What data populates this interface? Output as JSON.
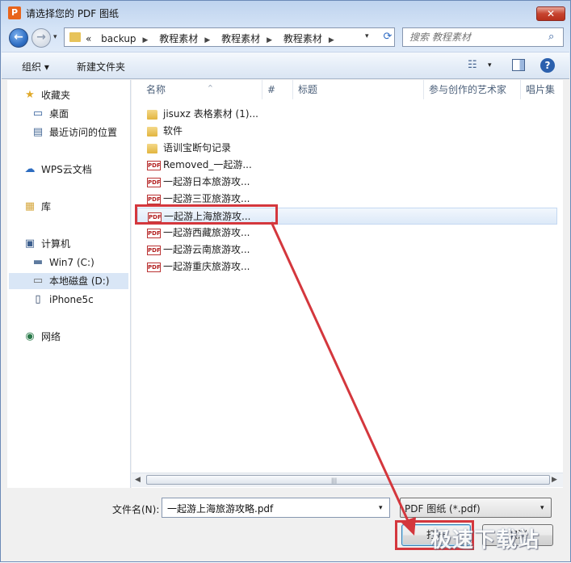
{
  "window": {
    "title": "请选择您的 PDF 图纸",
    "app_icon_letter": "P",
    "close_glyph": "✕"
  },
  "nav": {
    "back_glyph": "←",
    "forward_glyph": "→",
    "dropdown_glyph": "▾",
    "overflow": "«",
    "breadcrumbs": [
      "backup",
      "教程素材",
      "教程素材",
      "教程素材"
    ],
    "breadcrumb_sep": "▶",
    "search_placeholder": "搜索 教程素材"
  },
  "toolbar": {
    "organize": "组织 ▾",
    "new_folder": "新建文件夹",
    "views_glyph": "☷",
    "help_glyph": "?"
  },
  "sidebar": {
    "items": [
      {
        "label": "收藏夹",
        "icon": "★"
      },
      {
        "label": "桌面",
        "icon": "▭"
      },
      {
        "label": "最近访问的位置",
        "icon": "▤"
      },
      {
        "label": "WPS云文档",
        "icon": "☁"
      },
      {
        "label": "库",
        "icon": "▦"
      },
      {
        "label": "计算机",
        "icon": "▣"
      },
      {
        "label": "Win7 (C:)",
        "icon": "▬"
      },
      {
        "label": "本地磁盘 (D:)",
        "icon": "▭"
      },
      {
        "label": "iPhone5c",
        "icon": "▯"
      },
      {
        "label": "网络",
        "icon": "◉"
      }
    ]
  },
  "columns": [
    "名称",
    "#",
    "标题",
    "参与创作的艺术家",
    "唱片集"
  ],
  "files": [
    {
      "name": "jisuxz 表格素材 (1)...",
      "type": "folder"
    },
    {
      "name": "软件",
      "type": "folder"
    },
    {
      "name": "语训宝断句记录",
      "type": "folder"
    },
    {
      "name": "Removed_一起游...",
      "type": "pdf"
    },
    {
      "name": "一起游日本旅游攻...",
      "type": "pdf"
    },
    {
      "name": "一起游三亚旅游攻...",
      "type": "pdf"
    },
    {
      "name": "一起游上海旅游攻...",
      "type": "pdf",
      "selected": true
    },
    {
      "name": "一起游西藏旅游攻...",
      "type": "pdf"
    },
    {
      "name": "一起游云南旅游攻...",
      "type": "pdf"
    },
    {
      "name": "一起游重庆旅游攻...",
      "type": "pdf"
    }
  ],
  "pdf_icon_text": "PDF",
  "footer": {
    "filename_label": "文件名(N):",
    "filename_value": "一起游上海旅游攻略.pdf",
    "filetype_value": "PDF 图纸 (*.pdf)",
    "open_button": "打开",
    "cancel_button": "取消"
  },
  "watermark": "极速下载站",
  "colors": {
    "highlight": "#d4373d",
    "selection": "#dce9f8",
    "accent": "#2b60ad"
  }
}
